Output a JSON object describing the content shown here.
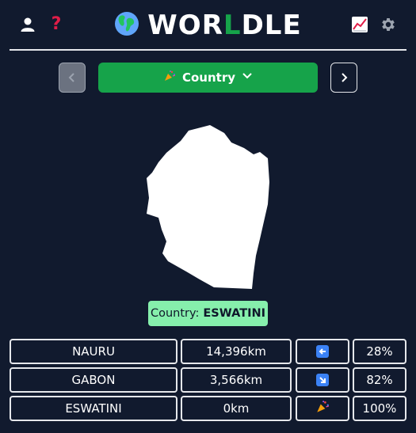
{
  "header": {
    "title_prefix": "WOR",
    "title_accent": "L",
    "title_suffix": "DLE",
    "icons": {
      "account": "user-icon",
      "help": "question-mark-icon",
      "stats": "chart-icon",
      "settings": "gear-icon",
      "globe": "globe-icon"
    },
    "help_glyph": "?"
  },
  "nav": {
    "prev_icon": "chevron-left-icon",
    "next_icon": "chevron-right-icon",
    "mode_label": "Country",
    "mode_icon": "party-popper-icon",
    "dropdown_icon": "chevron-down-icon"
  },
  "answer": {
    "label": "Country:",
    "value": "ESWATINI"
  },
  "guesses": [
    {
      "country": "NAURU",
      "distance": "14,396km",
      "direction": "west-arrow-icon",
      "proximity": "28%"
    },
    {
      "country": "GABON",
      "distance": "3,566km",
      "direction": "southeast-arrow-icon",
      "proximity": "82%"
    },
    {
      "country": "ESWATINI",
      "distance": "0km",
      "direction": "party-popper-icon",
      "proximity": "100%"
    }
  ],
  "colors": {
    "background": "#111a2e",
    "accent_green": "#16a34a",
    "answer_bg": "#86efac",
    "help_red": "#e11d48",
    "arrow_blue": "#3b82f6"
  }
}
